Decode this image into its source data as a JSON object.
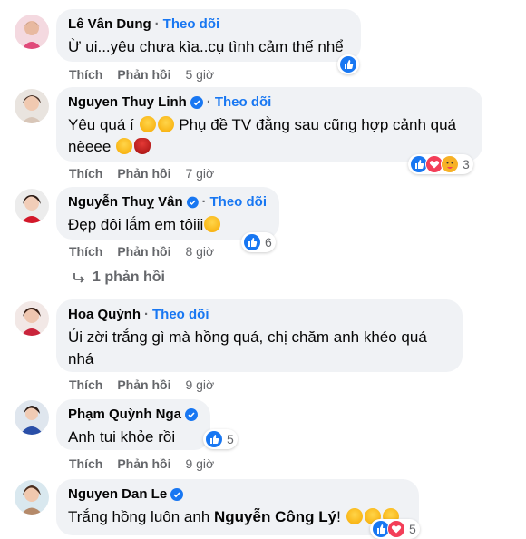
{
  "follow_label": "Theo dõi",
  "like_label": "Thích",
  "reply_label": "Phản hồi",
  "comments": [
    {
      "name": "Lê Vân Dung",
      "verified": false,
      "text": "Ừ ui...yêu chưa kìa..cụ tình cảm thế nhể",
      "time": "5 giờ",
      "reactions": [
        "like"
      ],
      "count": ""
    },
    {
      "name": "Nguyen Thuy Linh",
      "verified": true,
      "text": "Yêu quá í",
      "text2": "Phụ đề TV đằng sau cũng hợp cảnh quá",
      "text3": "nèeee",
      "time": "7 giờ",
      "reactions": [
        "like",
        "love",
        "care"
      ],
      "count": "3"
    },
    {
      "name": "Nguyễn Thuỵ Vân",
      "verified": true,
      "text": "Đẹp đôi lắm em tôiii",
      "time": "8 giờ",
      "reactions": [
        "like"
      ],
      "count": "6"
    },
    {
      "name": "Hoa Quỳnh",
      "verified": false,
      "text": "Úi zời trắng gì mà hồng quá, chị chăm anh khéo quá",
      "text2": "nhá",
      "time": "9 giờ",
      "reactions": [],
      "count": ""
    },
    {
      "name": "Phạm Quỳnh Nga",
      "verified": true,
      "text": "Anh tui khỏe rồi",
      "time": "9 giờ",
      "reactions": [
        "like"
      ],
      "count": "5"
    },
    {
      "name": "Nguyen Dan Le",
      "verified": true,
      "text": "Trắng hồng luôn anh",
      "mention": "Nguyễn Công Lý",
      "text_end": "!",
      "time": "",
      "reactions": [
        "like",
        "love"
      ],
      "count": "5"
    }
  ],
  "reply_thread": "1 phản hồi",
  "colors": {
    "accent": "#1877f2",
    "bubble": "#f0f2f5",
    "meta": "#65676b"
  }
}
